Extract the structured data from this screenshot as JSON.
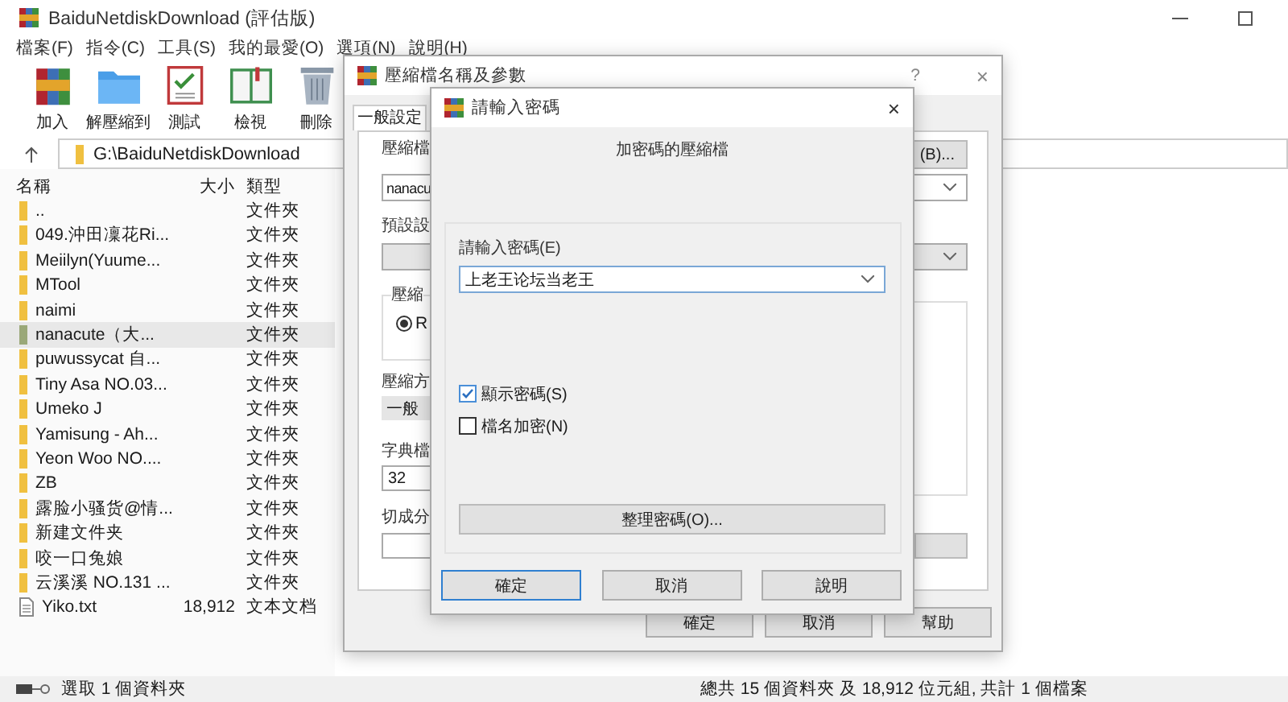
{
  "main_window": {
    "title": "BaiduNetdiskDownload (評估版)",
    "menu": [
      "檔案(F)",
      "指令(C)",
      "工具(S)",
      "我的最愛(O)",
      "選項(N)",
      "說明(H)"
    ],
    "toolbar": [
      {
        "kind": "add",
        "label": "加入"
      },
      {
        "kind": "extract",
        "label": "解壓縮到"
      },
      {
        "kind": "test",
        "label": "測試"
      },
      {
        "kind": "view",
        "label": "檢視"
      },
      {
        "kind": "delete",
        "label": "刪除"
      }
    ],
    "address": "G:\\BaiduNetdiskDownload",
    "columns": [
      "名稱",
      "大小",
      "類型"
    ],
    "files": [
      {
        "name": "..",
        "type": "文件夾",
        "kind": "folder",
        "selected": false
      },
      {
        "name": "049.沖田凜花Ri...",
        "type": "文件夾",
        "kind": "folder",
        "selected": false
      },
      {
        "name": "Meiilyn(Yuume...",
        "type": "文件夾",
        "kind": "folder",
        "selected": false
      },
      {
        "name": "MTool",
        "type": "文件夾",
        "kind": "folder",
        "selected": false
      },
      {
        "name": "naimi",
        "type": "文件夾",
        "kind": "folder",
        "selected": false
      },
      {
        "name": "nanacute（大...",
        "type": "文件夾",
        "kind": "folder",
        "selected": true
      },
      {
        "name": "puwussycat 自...",
        "type": "文件夾",
        "kind": "folder",
        "selected": false
      },
      {
        "name": "Tiny Asa NO.03...",
        "type": "文件夾",
        "kind": "folder",
        "selected": false
      },
      {
        "name": "Umeko J",
        "type": "文件夾",
        "kind": "folder",
        "selected": false
      },
      {
        "name": "Yamisung - Ah...",
        "type": "文件夾",
        "kind": "folder",
        "selected": false
      },
      {
        "name": "Yeon Woo NO....",
        "type": "文件夾",
        "kind": "folder",
        "selected": false
      },
      {
        "name": "ZB",
        "type": "文件夾",
        "kind": "folder",
        "selected": false
      },
      {
        "name": "露脸小骚货@情...",
        "type": "文件夾",
        "kind": "folder",
        "selected": false
      },
      {
        "name": "新建文件夹",
        "type": "文件夾",
        "kind": "folder",
        "selected": false
      },
      {
        "name": "咬一口兔娘",
        "type": "文件夾",
        "kind": "folder",
        "selected": false
      },
      {
        "name": "云溪溪 NO.131 ...",
        "type": "文件夾",
        "kind": "folder",
        "selected": false
      },
      {
        "name": "Yiko.txt",
        "size": "18,912",
        "type": "文本文档",
        "kind": "file",
        "selected": false
      }
    ],
    "status_left": "選取 1 個資料夾",
    "status_right": "總共 15 個資料夾 及 18,912 位元組, 共計 1 個檔案"
  },
  "archive_dialog": {
    "title": "壓縮檔名稱及參數",
    "help": "?",
    "close": "×",
    "tab": "一般設定",
    "name_label": "壓縮檔",
    "name_value": "nanacu",
    "browse_button": "(B)...",
    "profile_label": "預設設",
    "format_label": "壓縮",
    "format_option": "R",
    "method_label": "壓縮方",
    "method_value": "一般",
    "dict_label": "字典檔",
    "dict_value": "32",
    "split_label": "切成分",
    "buttons": [
      "確定",
      "取消",
      "幫助"
    ]
  },
  "password_dialog": {
    "title": "請輸入密碼",
    "close": "×",
    "heading": "加密碼的壓縮檔",
    "password_label": "請輸入密碼(E)",
    "password_value": "上老王论坛当老王",
    "options": [
      {
        "label": "顯示密碼(S)",
        "checked": true
      },
      {
        "label": "檔名加密(N)",
        "checked": false
      }
    ],
    "organize_button": "整理密碼(O)...",
    "buttons": [
      {
        "label": "確定",
        "selected": true
      },
      {
        "label": "取消",
        "selected": false
      },
      {
        "label": "說明",
        "selected": false
      }
    ]
  }
}
